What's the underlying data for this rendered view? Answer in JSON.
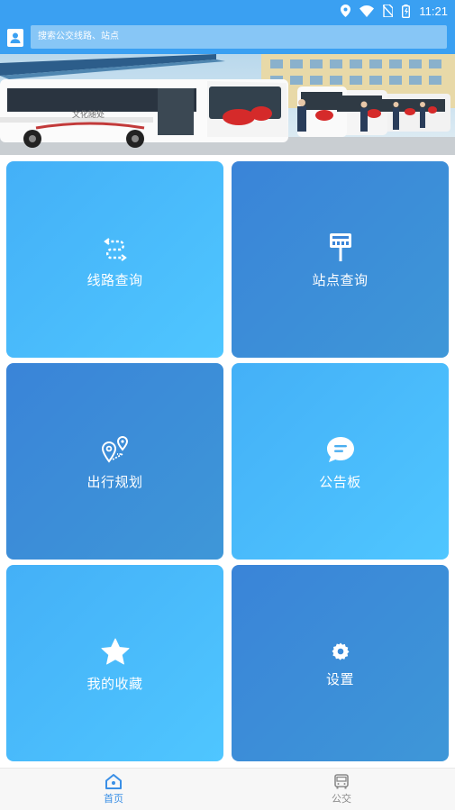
{
  "status_bar": {
    "time": "11:21",
    "icons": [
      "location-icon",
      "wifi-icon",
      "no-sim-icon",
      "battery-icon"
    ]
  },
  "search": {
    "placeholder": "搜索公交线路、站点"
  },
  "banner": {
    "bus_text": "文化随处"
  },
  "tiles": [
    {
      "label": "线路查询",
      "icon": "route-icon"
    },
    {
      "label": "站点查询",
      "icon": "bus-stop-icon"
    },
    {
      "label": "出行规划",
      "icon": "trip-plan-icon"
    },
    {
      "label": "公告板",
      "icon": "announcement-icon"
    },
    {
      "label": "我的收藏",
      "icon": "star-icon"
    },
    {
      "label": "设置",
      "icon": "gear-icon"
    }
  ],
  "bottom_nav": [
    {
      "label": "首页",
      "icon": "home-icon",
      "active": true
    },
    {
      "label": "公交",
      "icon": "bus-icon",
      "active": false
    }
  ],
  "colors": {
    "primary": "#3aa0f2",
    "tile_light": "#4fc6ff",
    "tile_dark": "#3a84d8",
    "active_nav": "#3a8fe6"
  }
}
